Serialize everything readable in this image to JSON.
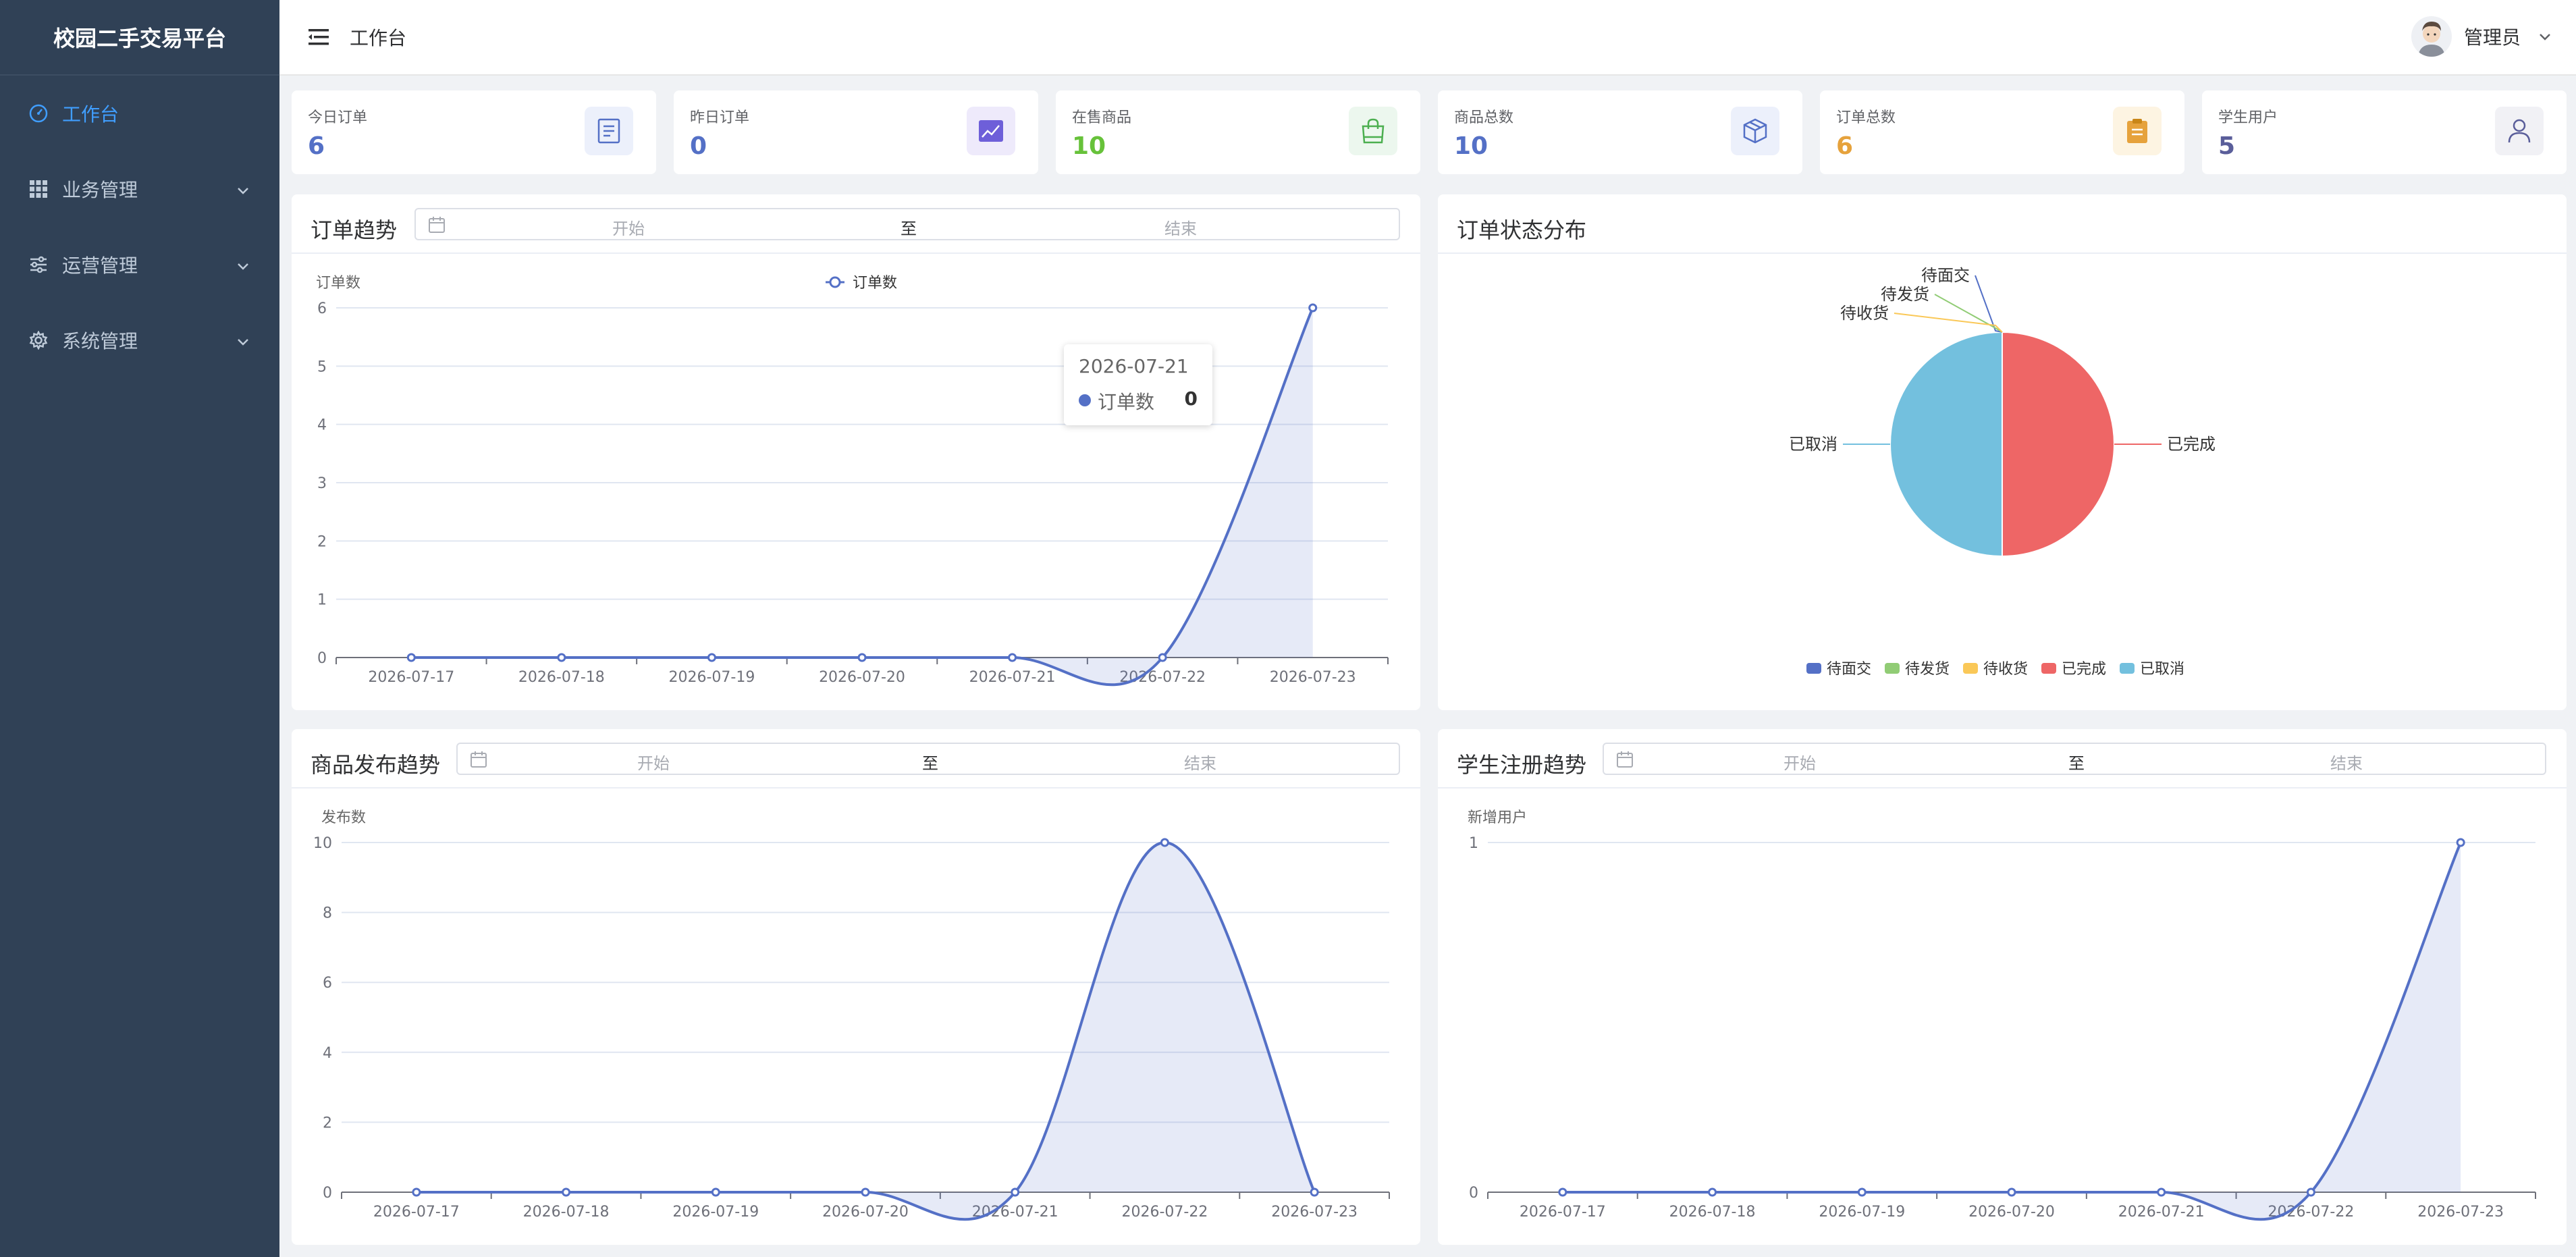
{
  "app": {
    "title": "校园二手交易平台"
  },
  "sidebar": {
    "items": [
      {
        "label": "工作台",
        "icon": "dashboard-icon",
        "active": true
      },
      {
        "label": "业务管理",
        "icon": "grid-icon"
      },
      {
        "label": "运营管理",
        "icon": "sliders-icon"
      },
      {
        "label": "系统管理",
        "icon": "gear-icon"
      }
    ]
  },
  "header": {
    "page_title": "工作台",
    "username": "管理员"
  },
  "stats": [
    {
      "label": "今日订单",
      "value": "6",
      "color": "#5470c6",
      "icon": "document-icon",
      "icon_bg": "#ecf0fb"
    },
    {
      "label": "昨日订单",
      "value": "0",
      "color": "#5470c6",
      "icon": "chart-up-icon",
      "icon_bg": "#eeeafb"
    },
    {
      "label": "在售商品",
      "value": "10",
      "color": "#67c23a",
      "icon": "shopping-bag-icon",
      "icon_bg": "#ecf7ee"
    },
    {
      "label": "商品总数",
      "value": "10",
      "color": "#5470c6",
      "icon": "box-icon",
      "icon_bg": "#ecf0fb"
    },
    {
      "label": "订单总数",
      "value": "6",
      "color": "#e6a23c",
      "icon": "clipboard-icon",
      "icon_bg": "#fdf4e2"
    },
    {
      "label": "学生用户",
      "value": "5",
      "color": "#5a5e9a",
      "icon": "user-icon",
      "icon_bg": "#f1f1f5"
    }
  ],
  "range": {
    "start_placeholder": "开始",
    "sep": "至",
    "end_placeholder": "结束"
  },
  "panels": {
    "order_trend": {
      "title": "订单趋势"
    },
    "order_status": {
      "title": "订单状态分布"
    },
    "product_trend": {
      "title": "商品发布趋势"
    },
    "student_trend": {
      "title": "学生注册趋势"
    }
  },
  "tooltip": {
    "date": "2026-07-21",
    "series": "订单数",
    "value": "0"
  },
  "chart_data": [
    {
      "type": "area",
      "ylabel": "订单数",
      "x": [
        "2026-07-17",
        "2026-07-18",
        "2026-07-19",
        "2026-07-20",
        "2026-07-21",
        "2026-07-22",
        "2026-07-23"
      ],
      "series": [
        {
          "name": "订单数",
          "values": [
            0,
            0,
            0,
            0,
            0,
            0,
            6
          ],
          "color": "#5470c6"
        }
      ],
      "yticks": [
        0,
        1,
        2,
        3,
        4,
        5,
        6
      ],
      "ylim": [
        0,
        6
      ],
      "legend": "top-center",
      "grid": true
    },
    {
      "type": "pie",
      "slices": [
        {
          "label": "待面交",
          "value": 0,
          "color": "#5470c6"
        },
        {
          "label": "待发货",
          "value": 0,
          "color": "#91cc75"
        },
        {
          "label": "待收货",
          "value": 0,
          "color": "#fac858"
        },
        {
          "label": "已完成",
          "value": 3,
          "color": "#ee6666"
        },
        {
          "label": "已取消",
          "value": 3,
          "color": "#73c0de"
        }
      ],
      "legend": "bottom-center"
    },
    {
      "type": "area",
      "ylabel": "发布数",
      "x": [
        "2026-07-17",
        "2026-07-18",
        "2026-07-19",
        "2026-07-20",
        "2026-07-21",
        "2026-07-22",
        "2026-07-23"
      ],
      "series": [
        {
          "values": [
            0,
            0,
            0,
            0,
            0,
            10,
            0
          ],
          "color": "#5470c6"
        }
      ],
      "yticks": [
        0,
        2,
        4,
        6,
        8,
        10
      ],
      "ylim": [
        0,
        10
      ],
      "grid": true
    },
    {
      "type": "area",
      "ylabel": "新增用户",
      "x": [
        "2026-07-17",
        "2026-07-18",
        "2026-07-19",
        "2026-07-20",
        "2026-07-21",
        "2026-07-22",
        "2026-07-23"
      ],
      "series": [
        {
          "values": [
            0,
            0,
            0,
            0,
            0,
            0,
            1
          ],
          "color": "#5470c6"
        }
      ],
      "yticks": [
        0,
        1
      ],
      "ylim": [
        0,
        1
      ],
      "grid": true
    }
  ]
}
